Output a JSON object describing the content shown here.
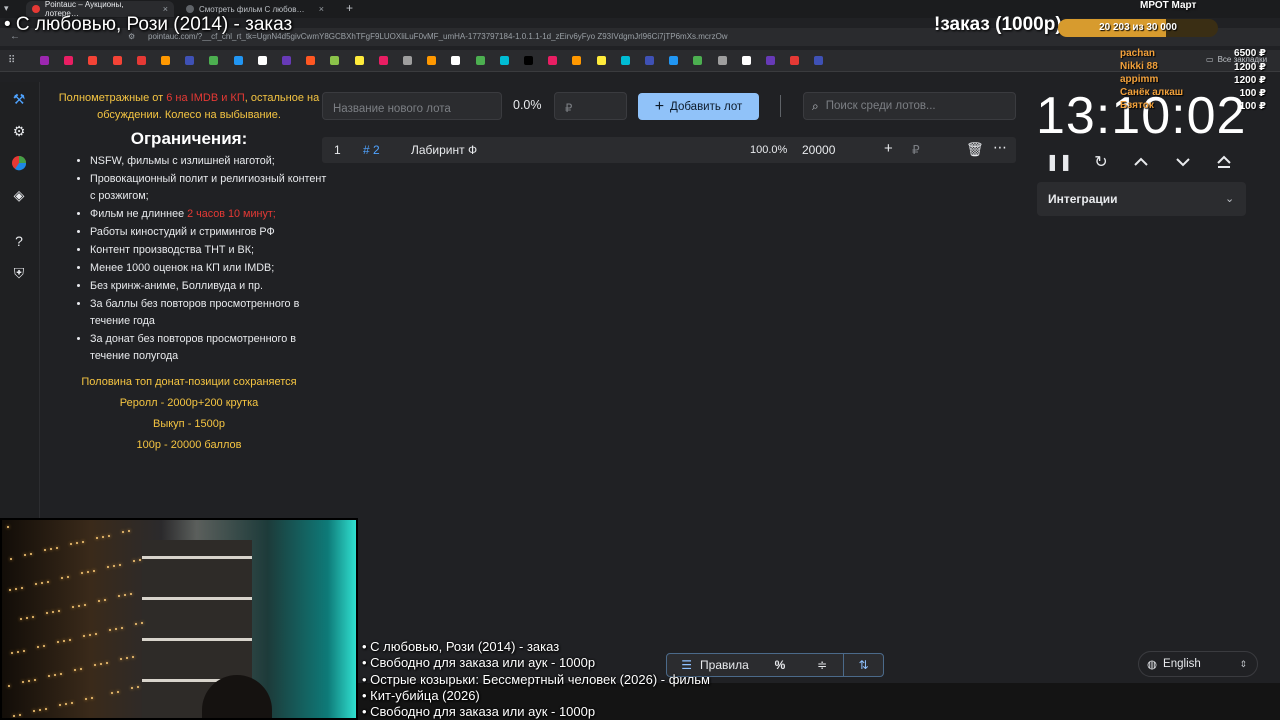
{
  "browser": {
    "tabs": [
      {
        "title": "Pointauc – Аукционы, лотере…",
        "active": true,
        "color": "#e53935"
      },
      {
        "title": "Смотреть фильм С любов…",
        "active": false,
        "color": "#5f6368"
      }
    ],
    "new_tab": "+",
    "url": "pointauc.com/?__cf_chl_rt_tk=UgnN4d5givCwmY8GCBXhTFgF9LUOXliLuF0vMF_umHA-1773797184-1.0.1.1-1d_zEirv6yFyo Z93IVdgmJrl96Ci7jTP6mXs.mcrzOw",
    "bookmarks_folder": "Все закладки"
  },
  "overlay": {
    "title": "• С любовью, Рози (2014) - заказ",
    "order_label": "!заказ (1000р)",
    "mrot_label": "МРОТ Март",
    "progress_text": "20 203  из 30 000",
    "progress_fraction": 0.673,
    "donors": [
      {
        "name": "pachan",
        "amount": "6500 ₽"
      },
      {
        "name": "Nikki 88",
        "amount": "1200 ₽"
      },
      {
        "name": "appimm",
        "amount": "1200 ₽"
      },
      {
        "name": "Санёк алкаш",
        "amount": "100 ₽"
      },
      {
        "name": "Бзяток",
        "amount": "100 ₽"
      }
    ]
  },
  "rules": {
    "intro_a": "Полнометражные от ",
    "intro_red": "6 на IMDB и КП",
    "intro_b": ", остальное на обсуждении. Колесо на выбывание.",
    "heading": "Ограничения:",
    "items": [
      "NSFW, фильмы с излишней наготой;",
      "Провокационный полит и религиозный контент с розжигом;",
      "Фильм не длиннее ",
      "Работы киностудий и стримингов РФ",
      "Контент производства ТНТ и ВК;",
      "Менее 1000 оценок на КП или IMDB;",
      "Без кринж-аниме, Болливуда и пр.",
      "За баллы без повторов просмотренного в течение года",
      "За донат без повторов просмотренного в течение полугода"
    ],
    "duration_red": "2 часов 10 минут;",
    "footer": [
      "Половина топ донат-позиции сохраняется",
      "Реролл - 2000р+200 крутка",
      "Выкуп - 1500р",
      "100р - 20000 баллов"
    ]
  },
  "controls": {
    "lot_name_placeholder": "Название нового лота",
    "percent": "0.0%",
    "amount_placeholder": "₽",
    "add_button": "Добавить лот",
    "search_placeholder": "Поиск среди лотов..."
  },
  "lots": [
    {
      "index": "1",
      "id": "# 2",
      "name": "Лабиринт Ф",
      "percent": "100.0%",
      "amount": "20000",
      "currency": "₽"
    }
  ],
  "timer": {
    "value": "13:10:02"
  },
  "integrations": {
    "label": "Интеграции"
  },
  "toolbar": {
    "rules_label": "Правила"
  },
  "language": {
    "label": "English"
  },
  "ticker": [
    "• С любовью, Рози (2014) - заказ",
    "• Свободно для заказа или аук - 1000р",
    "• Острые козырьки: Бессмертный человек (2026) - фильм",
    "• Кит-убийца (2026)",
    "• Свободно для заказа или аук - 1000р"
  ],
  "colors": {
    "accent": "#90c2f9",
    "yellow": "#f5c542",
    "red": "#e53935",
    "progress": "#d79b2e"
  }
}
